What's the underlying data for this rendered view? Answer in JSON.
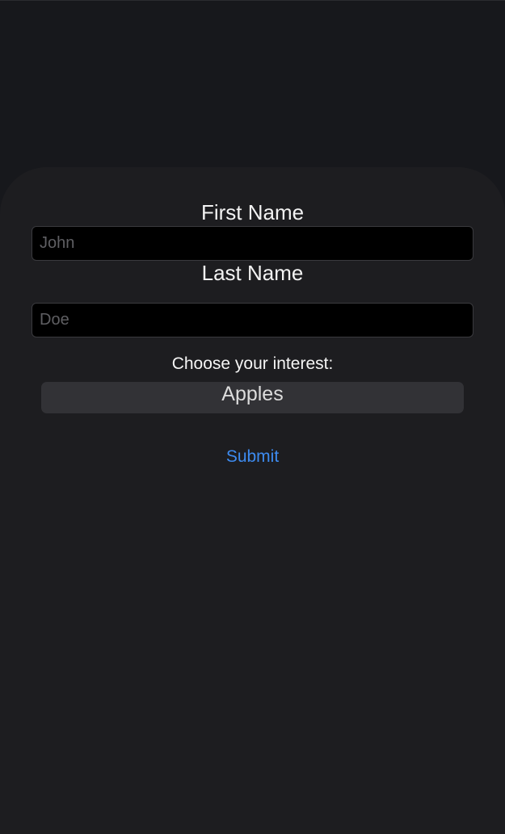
{
  "form": {
    "first_name": {
      "label": "First Name",
      "value": "",
      "placeholder": "John"
    },
    "last_name": {
      "label": "Last Name",
      "value": "",
      "placeholder": "Doe"
    },
    "interest": {
      "label": "Choose your interest:",
      "selected": "Apples"
    },
    "submit_label": "Submit"
  },
  "colors": {
    "page_background": "#17181c",
    "sheet_background": "#1d1d20",
    "input_background": "#000000",
    "select_background": "#323236",
    "accent": "#3d8bf0"
  }
}
